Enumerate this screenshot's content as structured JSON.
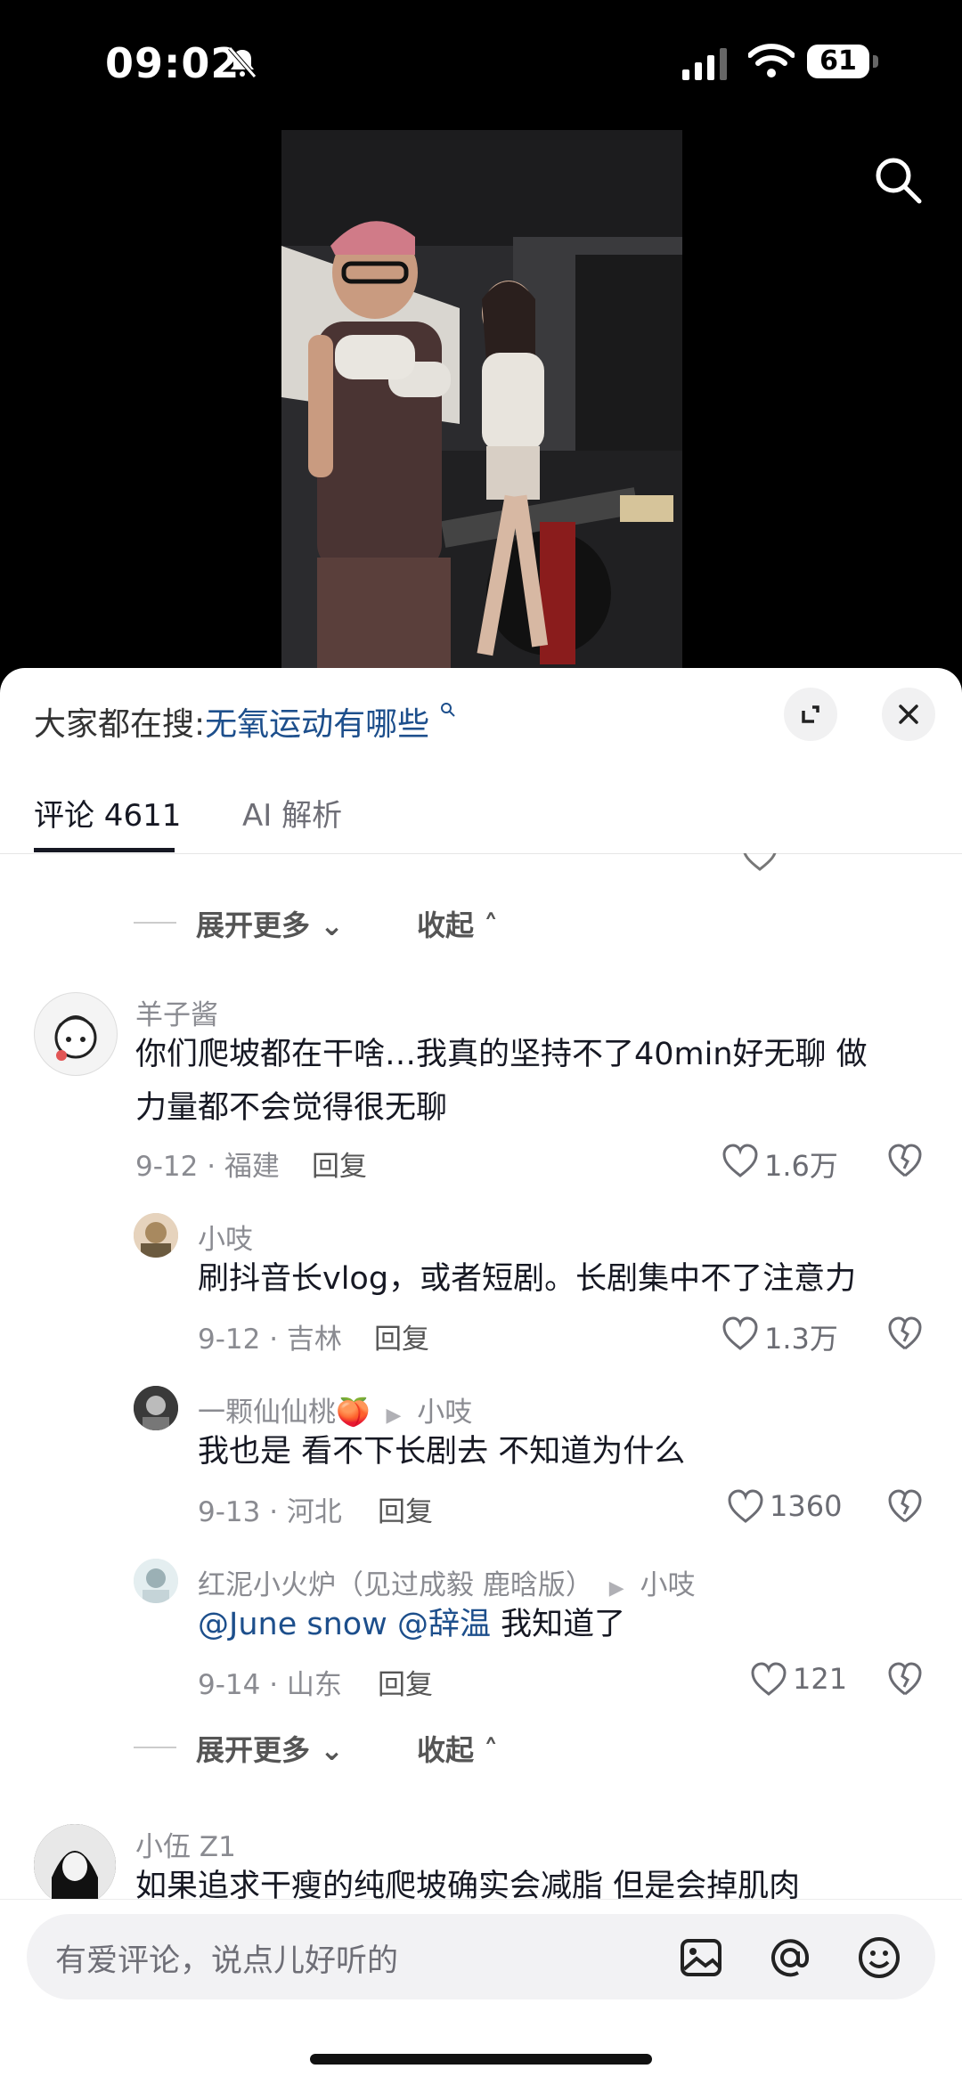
{
  "status": {
    "time": "09:02",
    "battery": "61"
  },
  "sheet": {
    "hot_search_prefix": "大家都在搜:",
    "hot_search_keyword": "无氧运动有哪些",
    "tabs": [
      {
        "label": "评论 4611"
      },
      {
        "label": "AI 解析"
      }
    ],
    "expand_label": "展开更多",
    "collapse_label": "收起"
  },
  "comments": [
    {
      "user": "羊子酱",
      "text_line1": "你们爬坡都在干啥…我真的坚持不了40min好无聊 做",
      "text_line2": "力量都不会觉得很无聊",
      "date_loc": "9-12 · 福建",
      "reply": "回复",
      "likes": "1.6万"
    },
    {
      "user": "小吱",
      "text": "刷抖音长vlog，或者短剧。长剧集中不了注意力",
      "date_loc": "9-12 · 吉林",
      "reply": "回复",
      "likes": "1.3万"
    },
    {
      "user": "一颗仙仙桃🍑",
      "reply_to": "小吱",
      "text": "我也是  看不下长剧去  不知道为什么",
      "date_loc": "9-13 · 河北",
      "reply": "回复",
      "likes": "1360"
    },
    {
      "user": "红泥小火炉（见过成毅 鹿晗版）",
      "reply_to": "小吱",
      "mention1": "@June snow",
      "mention2": "@辞温",
      "text": " 我知道了",
      "date_loc": "9-14 · 山东",
      "reply": "回复",
      "likes": "121"
    },
    {
      "user": "小伍 Z1",
      "text": "如果追求干瘦的纯爬坡确实会减脂 但是会掉肌肉"
    }
  ],
  "input": {
    "placeholder": "有爱评论，说点儿好听的"
  },
  "colors": {
    "link": "#1d4f8c",
    "muted": "#8a8b91",
    "text": "#161823"
  }
}
